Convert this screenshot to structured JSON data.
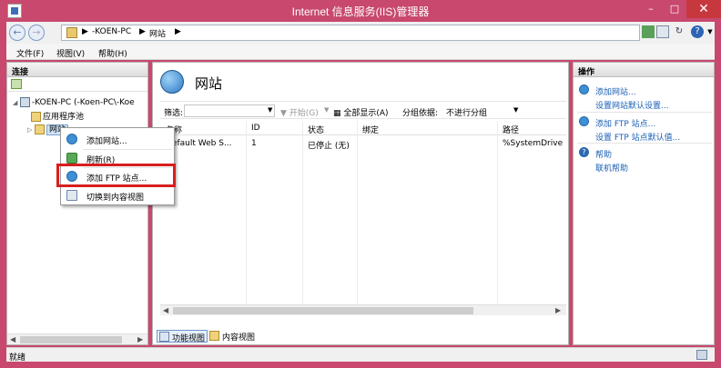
{
  "window": {
    "title": "Internet 信息服务(IIS)管理器",
    "controls": {
      "minimize": "–",
      "maximize": "□",
      "close": "✕"
    }
  },
  "address": {
    "sep": "▶",
    "crumbs": [
      "-KOEN-PC",
      "网站"
    ],
    "trail_arrow": "▶"
  },
  "menu": [
    "文件(F)",
    "视图(V)",
    "帮助(H)"
  ],
  "connections": {
    "title": "连接",
    "tree": {
      "server": "-KOEN-PC (-Koen-PC\\-Koe",
      "app_pools": "应用程序池",
      "sites": "网站"
    }
  },
  "main": {
    "title": "网站",
    "filter": {
      "label": "筛选:",
      "start": "开始(G)",
      "show_all": "全部显示(A)",
      "group_by_label": "分组依据:",
      "group_by_value": "不进行分组"
    },
    "columns": [
      "名称",
      "ID",
      "状态",
      "绑定",
      "路径"
    ],
    "rows": [
      {
        "name": "Default Web S...",
        "id": "1",
        "status": "已停止 (无)",
        "binding": "",
        "path": "%SystemDrive"
      }
    ],
    "views": {
      "features": "功能视图",
      "content": "内容视图"
    }
  },
  "actions": {
    "title": "操作",
    "items": [
      "添加网站...",
      "设置网站默认设置...",
      "添加 FTP 站点...",
      "设置 FTP 站点默认值...",
      "帮助",
      "联机帮助"
    ]
  },
  "context_menu": {
    "items": [
      "添加网站...",
      "刷新(R)",
      "添加 FTP 站点...",
      "切换到内容视图"
    ]
  },
  "status": {
    "text": "就绪"
  },
  "colors": {
    "frame": "#c8486e",
    "highlight": "#d81e1e",
    "link": "#1a5fb4"
  }
}
